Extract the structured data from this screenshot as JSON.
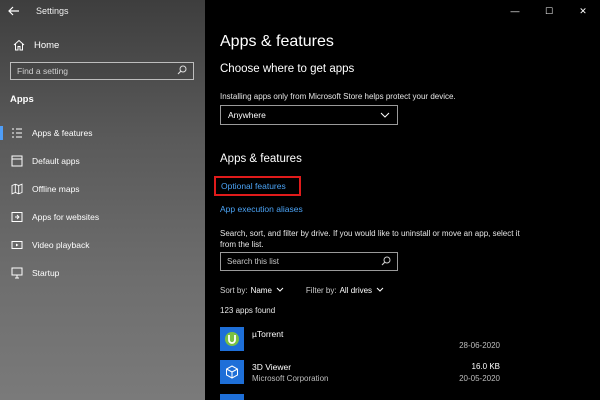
{
  "window": {
    "title": "Settings",
    "minimize_glyph": "—",
    "maximize_glyph": "☐",
    "close_glyph": "✕"
  },
  "sidebar": {
    "home_label": "Home",
    "search_placeholder": "Find a setting",
    "section_label": "Apps",
    "items": [
      {
        "label": "Apps & features",
        "icon": "apps-features-icon",
        "selected": true
      },
      {
        "label": "Default apps",
        "icon": "default-apps-icon",
        "selected": false
      },
      {
        "label": "Offline maps",
        "icon": "offline-maps-icon",
        "selected": false
      },
      {
        "label": "Apps for websites",
        "icon": "apps-for-websites-icon",
        "selected": false
      },
      {
        "label": "Video playback",
        "icon": "video-playback-icon",
        "selected": false
      },
      {
        "label": "Startup",
        "icon": "startup-icon",
        "selected": false
      }
    ]
  },
  "main": {
    "page_title": "Apps & features",
    "choose_heading": "Choose where to get apps",
    "store_info": "Installing apps only from Microsoft Store helps protect your device.",
    "source_value": "Anywhere",
    "apps_heading": "Apps & features",
    "optional_features_link": "Optional features",
    "execution_aliases_link": "App execution aliases",
    "description": "Search, sort, and filter by drive. If you would like to uninstall or move an app, select it from the list.",
    "search_list_placeholder": "Search this list",
    "sort_label": "Sort by:",
    "sort_value": "Name",
    "filter_label": "Filter by:",
    "filter_value": "All drives",
    "apps_count": "123 apps found",
    "apps": [
      {
        "name": "µTorrent",
        "publisher": "",
        "size": "",
        "date": "28-06-2020",
        "icon": "utorrent-icon"
      },
      {
        "name": "3D Viewer",
        "publisher": "Microsoft Corporation",
        "size": "16.0 KB",
        "date": "20-05-2020",
        "icon": "3d-viewer-icon"
      }
    ]
  },
  "colors": {
    "accent": "#4f9ef8",
    "link": "#4ba3f5",
    "highlight_box": "#e01b1b",
    "app_tile": "#1e6fd8"
  }
}
